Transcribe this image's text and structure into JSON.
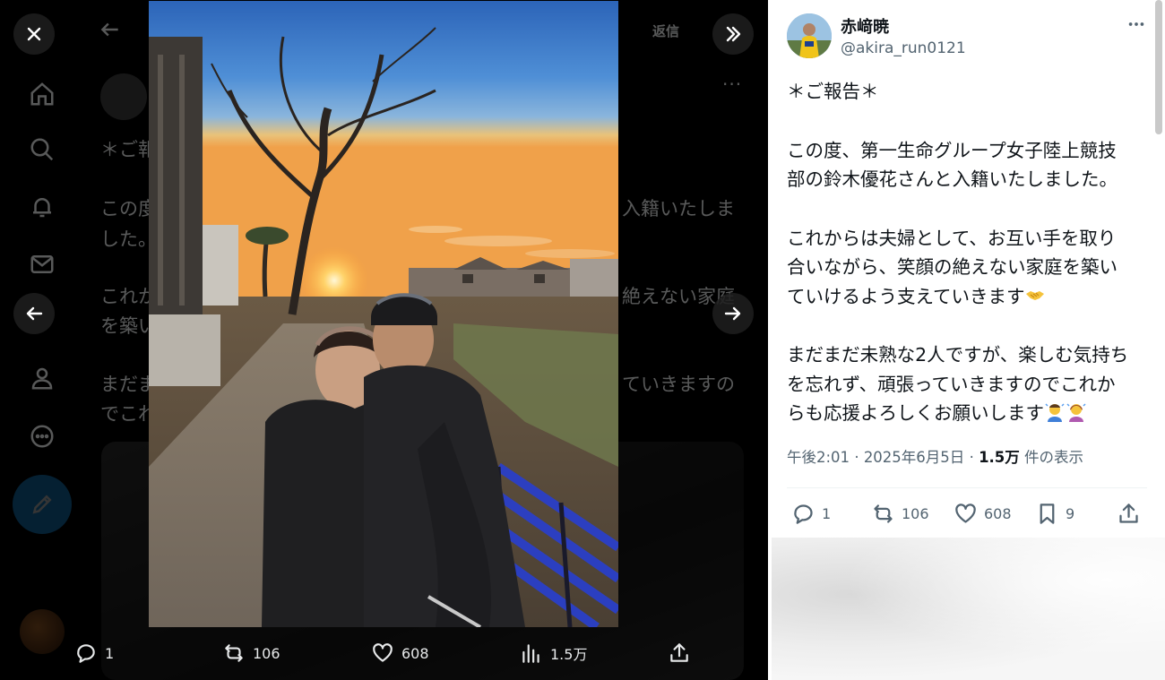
{
  "viewer": {
    "background_text": {
      "line1": "＊ご報告＊",
      "line2a": "この度",
      "line2b": "入籍いたしま",
      "line3": "した。",
      "line4a": "これか",
      "line4b": "絶えない家庭",
      "line5": "を築い",
      "line6a": "まだま",
      "line6b": "ていきますの",
      "line7": "でこれ",
      "reply_label": "返信"
    },
    "actions": {
      "reply_count": "1",
      "retweet_count": "106",
      "like_count": "608",
      "views_count": "1.5万"
    }
  },
  "post": {
    "display_name": "赤﨑暁",
    "handle": "@akira_run0121",
    "text": {
      "heading": "＊ご報告＊",
      "p1_l1": "この度、第一生命グループ女子陸上競技",
      "p1_l2": "部の鈴木優花さんと入籍いたしました。",
      "p2_l1": "これからは夫婦として、お互い手を取り",
      "p2_l2": "合いながら、笑顔の絶えない家庭を築い",
      "p2_l3": "ていけるよう支えていきます",
      "p3_l1": "まだまだ未熟な2人ですが、楽しむ気持ち",
      "p3_l2": "を忘れず、頑張っていきますのでこれか",
      "p3_l3": "らも応援よろしくお願いします"
    },
    "meta": {
      "time": "午後2:01",
      "separator": "·",
      "date": "2025年6月5日",
      "views": "1.5万",
      "views_label": "件の表示"
    },
    "actions": {
      "reply_count": "1",
      "retweet_count": "106",
      "like_count": "608",
      "bookmark_count": "9"
    }
  },
  "icons": {
    "close": "close-icon",
    "collapse": "double-chevron-right-icon",
    "prev": "arrow-left-icon",
    "next": "arrow-right-icon",
    "reply": "reply-icon",
    "retweet": "retweet-icon",
    "like": "heart-icon",
    "views": "views-icon",
    "share": "share-icon",
    "bookmark": "bookmark-icon",
    "more": "more-icon"
  },
  "colors": {
    "accent": "#1d9bf0",
    "secondary_text": "#536471",
    "primary_text": "#0f1419"
  }
}
